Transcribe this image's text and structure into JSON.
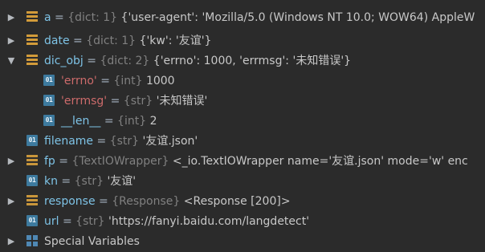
{
  "variables": [
    {
      "name": "a",
      "type": "{dict: 1}",
      "value": "{'user-agent': 'Mozilla/5.0 (Windows NT 10.0; WOW64) AppleW",
      "expanded": false,
      "icon": "dict-icon"
    },
    {
      "name": "date",
      "type": "{dict: 1}",
      "value": "{'kw': '友谊'}",
      "expanded": false,
      "icon": "dict-icon"
    },
    {
      "name": "dic_obj",
      "type": "{dict: 2}",
      "value": "{'errno': 1000, 'errmsg': '未知错误'}",
      "expanded": true,
      "icon": "dict-icon",
      "children": [
        {
          "name": "'errno'",
          "type": "{int}",
          "value": "1000",
          "icon": "primitive-icon"
        },
        {
          "name": "'errmsg'",
          "type": "{str}",
          "value": "'未知错误'",
          "icon": "primitive-icon"
        },
        {
          "name": "__len__",
          "type": "{int}",
          "value": "2",
          "icon": "primitive-icon"
        }
      ]
    },
    {
      "name": "filename",
      "type": "{str}",
      "value": "'友谊.json'",
      "expanded": false,
      "icon": "primitive-icon"
    },
    {
      "name": "fp",
      "type": "{TextIOWrapper}",
      "value": "<_io.TextIOWrapper name='友谊.json' mode='w' enc",
      "expanded": false,
      "icon": "object-icon"
    },
    {
      "name": "kn",
      "type": "{str}",
      "value": "'友谊'",
      "expanded": false,
      "icon": "primitive-icon"
    },
    {
      "name": "response",
      "type": "{Response}",
      "value": "<Response [200]>",
      "expanded": false,
      "icon": "object-icon"
    },
    {
      "name": "url",
      "type": "{str}",
      "value": "'https://fanyi.baidu.com/langdetect'",
      "expanded": false,
      "icon": "primitive-icon"
    }
  ],
  "special_variables": {
    "label": "Special Variables",
    "icon": "grid-icon"
  },
  "separator": " = ",
  "icons": {
    "expand": "▶",
    "collapse": "▼",
    "primitive_badge": "01"
  },
  "colors": {
    "background": "#2b2b2b",
    "name": "#7ec3e6",
    "dict_key": "#cc6b6b",
    "type": "#808080",
    "value": "#c8c8c8",
    "dict_icon": "#d29b3a",
    "primitive_icon": "#3d7a9e"
  }
}
